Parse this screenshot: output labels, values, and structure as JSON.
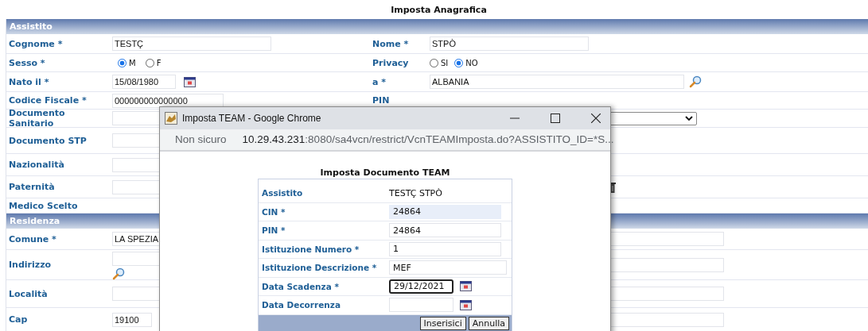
{
  "page_title": "Imposta Anagrafica",
  "sections": [
    {
      "title": "Assistito",
      "rows": [
        {
          "label": "Cognome *",
          "field": {
            "kind": "wide",
            "value": "TESTÇ"
          },
          "right": {
            "label": "Nome *",
            "field": {
              "kind": "wide",
              "value": "STPÒ"
            }
          }
        },
        {
          "label": "Sesso *",
          "field": {
            "kind": "radio",
            "options": [
              {
                "label": "M",
                "selected": true
              },
              {
                "label": "F",
                "selected": false
              }
            ]
          },
          "right": {
            "label": "Privacy",
            "field": {
              "kind": "radio",
              "options": [
                {
                  "label": "SI",
                  "selected": false
                },
                {
                  "label": "NO",
                  "selected": true
                }
              ]
            }
          }
        },
        {
          "label": "Nato il *",
          "field": {
            "kind": "date",
            "value": "15/08/1980"
          },
          "right": {
            "label": "a *",
            "field": {
              "kind": "lookup",
              "value": "ALBANIA"
            }
          }
        },
        {
          "label": "Codice Fiscale *",
          "field": {
            "kind": "text",
            "value": "000000000000000"
          },
          "right": {
            "label": "PIN"
          }
        },
        {
          "label": "Documento Sanitario",
          "field": {
            "kind": "text"
          },
          "right": {
            "field": {
              "kind": "select"
            }
          }
        },
        {
          "label": "Documento STP",
          "field": {
            "kind": "text"
          }
        },
        {
          "label": "Nazionalità",
          "field": {
            "kind": "text"
          }
        },
        {
          "label": "Paternità",
          "field": {
            "kind": "text"
          },
          "right": {
            "field": {
              "kind": "trash"
            }
          }
        },
        {
          "label": "Medico Scelto"
        }
      ]
    },
    {
      "title": "Residenza",
      "rows": [
        {
          "label": "Comune *",
          "field": {
            "kind": "text",
            "value": "LA SPEZIA"
          },
          "right": {
            "field": {
              "kind": "long"
            }
          }
        },
        {
          "label": "Indirizzo",
          "field": {
            "kind": "address"
          },
          "right": {
            "field": {
              "kind": "long"
            }
          }
        },
        {
          "label": "Località",
          "field": {
            "kind": "text"
          },
          "right": {
            "field": {
              "kind": "long"
            }
          }
        },
        {
          "label": "Cap",
          "field": {
            "kind": "short",
            "value": "19100"
          },
          "right": {
            "field": {
              "kind": "long"
            }
          }
        }
      ]
    }
  ],
  "popup": {
    "window_title": "Imposta TEAM - Google Chrome",
    "security": "Non sicuro",
    "url_host": "10.29.43.231",
    "url_rest": ":8080/sa4vcn/restrict/VcnTEAMImposta.do?ASSISTITO_ID=*S...",
    "title": "Imposta Documento TEAM",
    "rows": [
      {
        "label": "Assistito",
        "kind": "static",
        "value": "TESTÇ STPÒ"
      },
      {
        "label": "CIN *",
        "kind": "text",
        "value": "24864",
        "readonly": true,
        "focused": false
      },
      {
        "label": "PIN *",
        "kind": "text",
        "value": "24864",
        "readonly": false,
        "focused": false
      },
      {
        "label": "Istituzione Numero *",
        "kind": "text",
        "value": "1",
        "readonly": false,
        "focused": false
      },
      {
        "label": "Istituzione Descrizione *",
        "kind": "wide",
        "value": "MEF",
        "readonly": false,
        "focused": false
      },
      {
        "label": "Data Scadenza *",
        "kind": "date",
        "value": "29/12/2021",
        "readonly": false,
        "focused": true
      },
      {
        "label": "Data Decorrenza",
        "kind": "date",
        "readonly": false,
        "focused": false
      }
    ],
    "buttons": [
      "Inserisici",
      "Annulla"
    ]
  }
}
